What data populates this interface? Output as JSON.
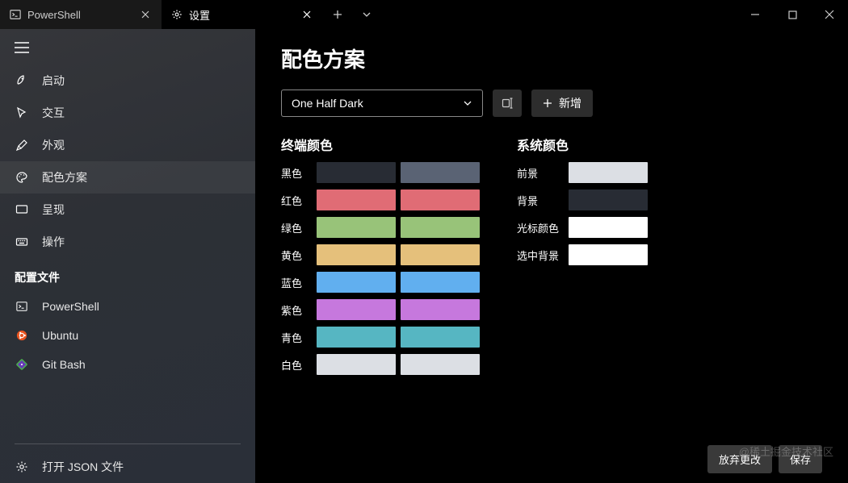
{
  "titlebar": {
    "tabs": [
      {
        "label": "PowerShell",
        "icon": "terminal-icon",
        "active": false
      },
      {
        "label": "设置",
        "icon": "gear-icon",
        "active": true
      }
    ]
  },
  "sidebar": {
    "nav": [
      {
        "key": "startup",
        "icon": "rocket-icon",
        "label": "启动"
      },
      {
        "key": "interaction",
        "icon": "cursor-icon",
        "label": "交互"
      },
      {
        "key": "appearance",
        "icon": "brush-icon",
        "label": "外观"
      },
      {
        "key": "color-schemes",
        "icon": "palette-icon",
        "label": "配色方案",
        "active": true
      },
      {
        "key": "rendering",
        "icon": "monitor-icon",
        "label": "呈现"
      },
      {
        "key": "actions",
        "icon": "keyboard-icon",
        "label": "操作"
      }
    ],
    "profiles_label": "配置文件",
    "profiles": [
      {
        "key": "powershell",
        "icon": "terminal-icon",
        "label": "PowerShell"
      },
      {
        "key": "ubuntu",
        "icon": "ubuntu-icon",
        "label": "Ubuntu"
      },
      {
        "key": "gitbash",
        "icon": "gitbash-icon",
        "label": "Git Bash"
      }
    ],
    "open_json_label": "打开 JSON 文件"
  },
  "content": {
    "title": "配色方案",
    "scheme_select_value": "One Half Dark",
    "add_label": "新增",
    "terminal_colors_title": "终端颜色",
    "system_colors_title": "系统颜色",
    "terminal_colors": [
      {
        "label": "黑色",
        "c1": "#282c34",
        "c2": "#5a6374"
      },
      {
        "label": "红色",
        "c1": "#e06c75",
        "c2": "#e06c75"
      },
      {
        "label": "绿色",
        "c1": "#98c379",
        "c2": "#98c379"
      },
      {
        "label": "黄色",
        "c1": "#e5c07b",
        "c2": "#e5c07b"
      },
      {
        "label": "蓝色",
        "c1": "#61afef",
        "c2": "#61afef"
      },
      {
        "label": "紫色",
        "c1": "#c678dd",
        "c2": "#c678dd"
      },
      {
        "label": "青色",
        "c1": "#56b6c2",
        "c2": "#56b6c2"
      },
      {
        "label": "白色",
        "c1": "#dcdfe4",
        "c2": "#dcdfe4"
      }
    ],
    "system_colors": [
      {
        "label": "前景",
        "c": "#dcdfe4"
      },
      {
        "label": "背景",
        "c": "#282c34"
      },
      {
        "label": "光标颜色",
        "c": "#ffffff"
      },
      {
        "label": "选中背景",
        "c": "#ffffff"
      }
    ],
    "discard_label": "放弃更改",
    "save_label": "保存"
  },
  "watermark": "@稀土掘金技术社区"
}
